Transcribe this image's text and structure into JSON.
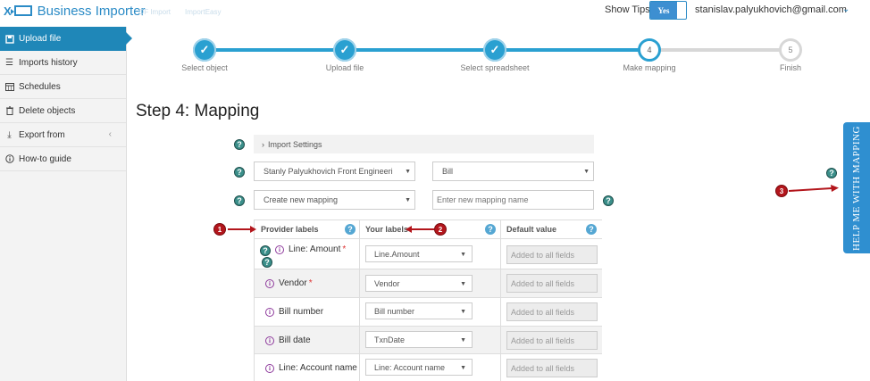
{
  "header": {
    "app_title": "Business Importer",
    "faint_links": [
      "QF Import",
      "ImportEasy"
    ],
    "show_tips_label": "Show Tips",
    "toggle_value": "Yes",
    "user_email": "stanislav.palyukhovich@gmail.com"
  },
  "sidebar": {
    "items": [
      {
        "label": "Upload file",
        "icon": "upload-icon",
        "active": true
      },
      {
        "label": "Imports history",
        "icon": "list-icon"
      },
      {
        "label": "Schedules",
        "icon": "calendar-icon"
      },
      {
        "label": "Delete objects",
        "icon": "trash-icon"
      },
      {
        "label": "Export from",
        "icon": "download-icon"
      },
      {
        "label": "How-to guide",
        "icon": "info-icon"
      }
    ]
  },
  "progress": {
    "steps": [
      {
        "label": "Select object",
        "state": "done"
      },
      {
        "label": "Upload file",
        "state": "done"
      },
      {
        "label": "Select spreadsheet",
        "state": "done"
      },
      {
        "label": "Make mapping",
        "state": "current",
        "number": "4"
      },
      {
        "label": "Finish",
        "state": "future",
        "number": "5"
      }
    ],
    "accent": "#2aa0d1"
  },
  "page": {
    "title": "Step 4: Mapping"
  },
  "form": {
    "import_settings": "Import Settings",
    "company_select": "Stanly Palyukhovich Front Engineeri",
    "object_select": "Bill",
    "mapping_select": "Create new mapping",
    "mapping_name_placeholder": "Enter new mapping name"
  },
  "table": {
    "headers": [
      "Provider labels",
      "Your labels",
      "Default value"
    ],
    "default_placeholder": "Added to all fields",
    "rows": [
      {
        "provider": "Line: Amount",
        "required": true,
        "your": "Line.Amount"
      },
      {
        "provider": "Vendor",
        "required": true,
        "your": "Vendor"
      },
      {
        "provider": "Bill number",
        "required": false,
        "your": "Bill number"
      },
      {
        "provider": "Bill date",
        "required": false,
        "your": "TxnDate"
      },
      {
        "provider": "Line: Account name",
        "required": false,
        "your": "Line: Account name"
      }
    ]
  },
  "annotations": [
    "1",
    "2",
    "3"
  ],
  "help_tab": "HELP ME WITH MAPPING",
  "colors": {
    "primary": "#2b8bc6",
    "sidebar_active": "#1f87b8",
    "annotation": "#b3161c"
  }
}
